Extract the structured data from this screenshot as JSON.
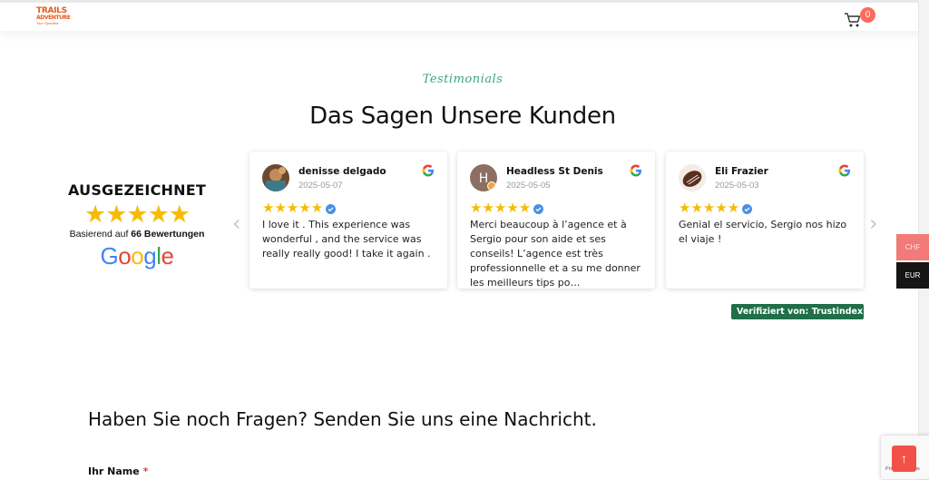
{
  "header": {
    "logo": {
      "line1": "TRAILS",
      "line2": "ADVENTURE",
      "line3": "Tour Operator"
    },
    "cart": {
      "icon": "cart-icon",
      "count": "0"
    }
  },
  "testimonials": {
    "eyebrow": "Testimonials",
    "title": "Das Sagen Unsere Kunden",
    "summary": {
      "rating_label": "AUSGEZEICHNET",
      "stars": "★★★★★",
      "basis_prefix": "Basierend auf",
      "basis_count": "66 Bewertungen",
      "brand": "Google"
    },
    "reviews": [
      {
        "name": "denisse delgado",
        "date": "2025-05-07",
        "stars": "★★★★★",
        "text": "I love it . This experience was wonderful , and the service was really really good! I take it again ."
      },
      {
        "name": "Headless St Denis",
        "date": "2025-05-05",
        "stars": "★★★★★",
        "text": "Merci beaucoup à l’agence et à Sergio pour son aide et ses conseils! L’agence est très professionnelle et a su me donner les meilleurs tips po…",
        "avatar_letter": "H"
      },
      {
        "name": "Eli Frazier",
        "date": "2025-05-03",
        "stars": "★★★★★",
        "text": "Genial el servicio, Sergio nos hizo el viaje !"
      }
    ],
    "arrows": {
      "prev": "‹",
      "next": "›"
    },
    "verified_badge": "Verifiziert von: Trustindex",
    "verified_info": "i"
  },
  "currency": {
    "options": [
      "CHF",
      "EUR"
    ]
  },
  "contact": {
    "title": "Haben Sie noch Fragen? Senden Sie uns eine Nachricht.",
    "name_label": "Ihr Name",
    "required_mark": "*"
  },
  "recaptcha": {
    "text": "Privacy - Terms"
  },
  "back_to_top": "↑",
  "colors": {
    "accent": "#f35147",
    "star": "#f6bb06",
    "trust_green": "#1f6f48",
    "eyebrow": "#3aa58a"
  }
}
